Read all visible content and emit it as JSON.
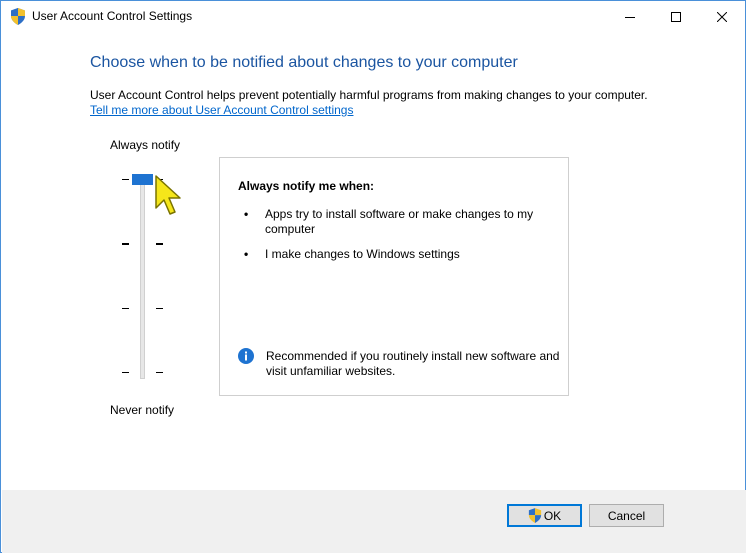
{
  "window": {
    "title": "User Account Control Settings",
    "icon": "shield-icon"
  },
  "main": {
    "heading": "Choose when to be notified about changes to your computer",
    "description": "User Account Control helps prevent potentially harmful programs from making changes to your computer.",
    "learn_more_link": "Tell me more about User Account Control settings"
  },
  "slider": {
    "top_label": "Always notify",
    "bottom_label": "Never notify",
    "levels": 4,
    "selected_level": 4
  },
  "info": {
    "title": "Always notify me when:",
    "bullets": [
      "Apps try to install software or make changes to my computer",
      "I make changes to Windows settings"
    ],
    "recommendation": "Recommended if you routinely install new software and visit unfamiliar websites.",
    "recommendation_icon": "info-icon"
  },
  "buttons": {
    "ok": "OK",
    "cancel": "Cancel"
  },
  "colors": {
    "heading": "#1b55a1",
    "link": "#0066cc",
    "accent": "#1e73d1"
  }
}
